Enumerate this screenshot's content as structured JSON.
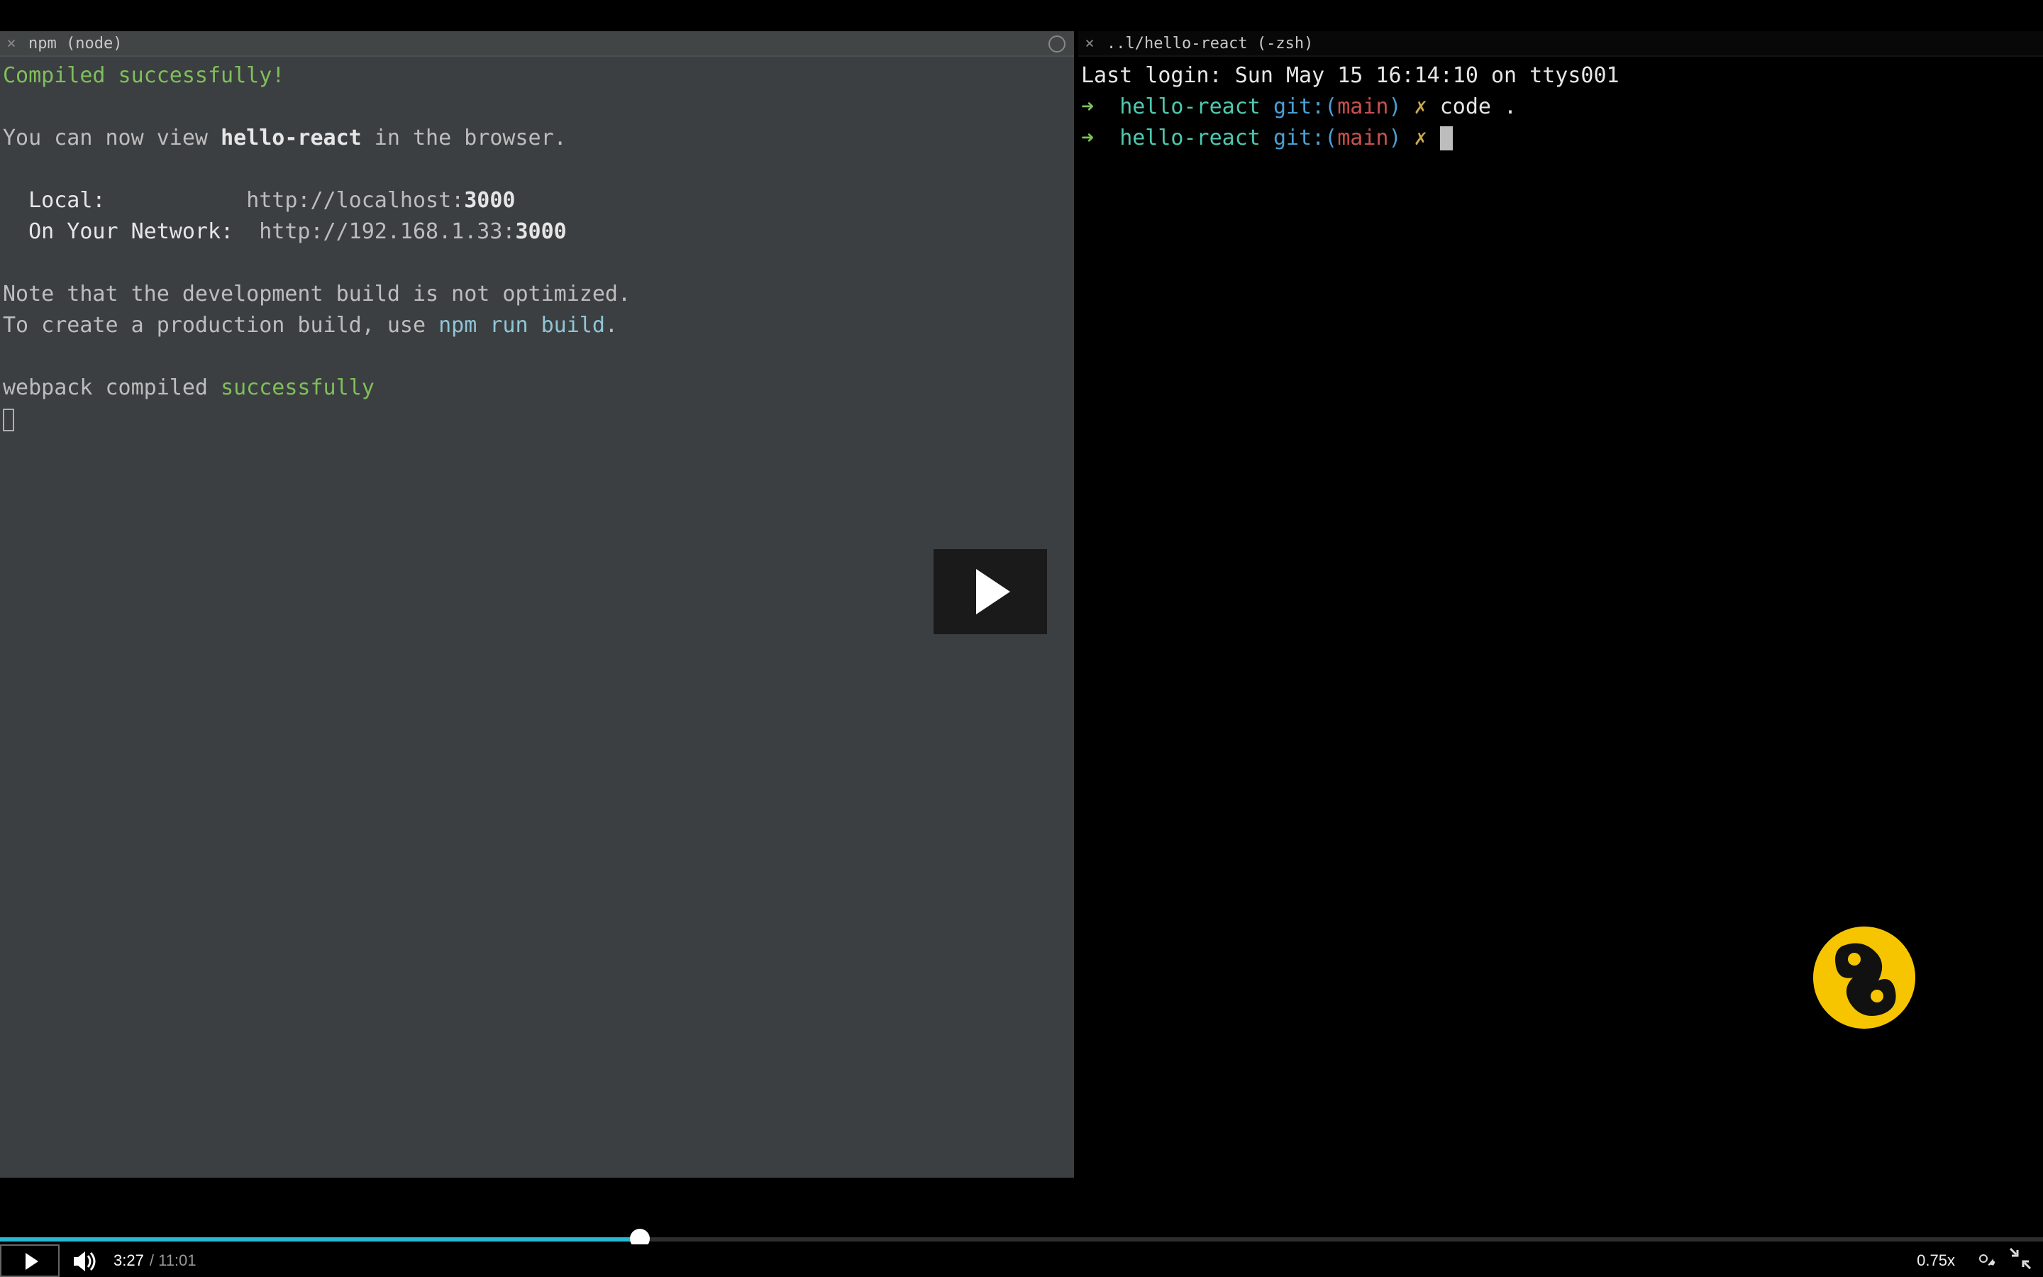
{
  "left_pane": {
    "tab_close_glyph": "×",
    "tab_title": "npm (node)",
    "lines": {
      "compiled": "Compiled successfully!",
      "view_pre": "You can now view ",
      "app_name": "hello-react",
      "view_post": " in the browser.",
      "local_label": "  Local:           ",
      "local_url_pre": "http://localhost:",
      "local_port": "3000",
      "net_label": "  On Your Network:  ",
      "net_url_pre": "http://192.168.1.33:",
      "net_port": "3000",
      "note1": "Note that the development build is not optimized.",
      "note2_pre": "To create a production build, use ",
      "note2_cmd": "npm run build",
      "note2_post": ".",
      "webpack_pre": "webpack compiled ",
      "webpack_ok": "successfully"
    }
  },
  "right_pane": {
    "tab_close_glyph": "×",
    "tab_title": "..l/hello-react (-zsh)",
    "last_login": "Last login: Sun May 15 16:14:10 on ttys001",
    "prompt": {
      "arrow": "➜",
      "dir": "hello-react",
      "git_pre": "git:(",
      "branch": "main",
      "git_post": ")",
      "dirty": "✗"
    },
    "cmd1": "code ."
  },
  "player": {
    "current_time": "3:27",
    "duration": "11:01",
    "speed_label": "0.75x",
    "progress_fraction": 0.313
  },
  "colors": {
    "accent": "#27b9d4",
    "logo_bg": "#f6c500"
  }
}
